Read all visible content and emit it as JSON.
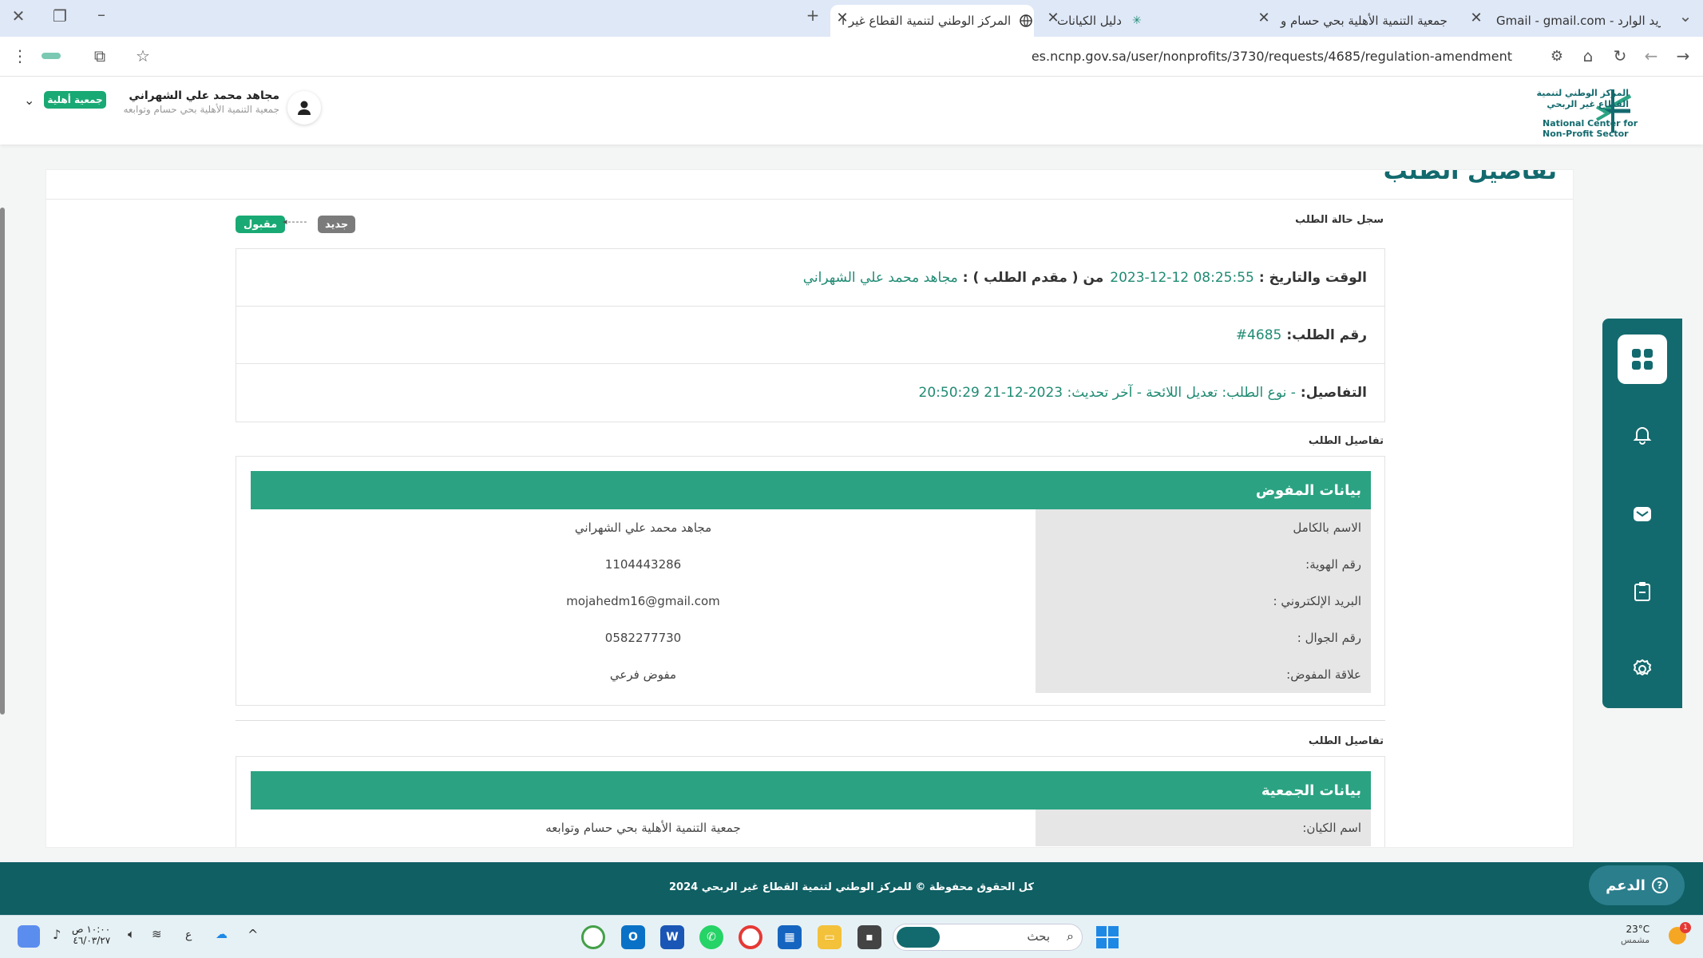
{
  "browser": {
    "tabs": [
      {
        "title": "البريد الوارد - Gmail - gmail.com",
        "favicon": "gmail-icon"
      },
      {
        "title": "جمعية التنمية الأهلية بحي حسام و",
        "favicon": "r-icon"
      },
      {
        "title": "دليل الكيانات",
        "favicon": "ncnp-icon"
      },
      {
        "title": "المركز الوطني لتنمية القطاع غير ا",
        "favicon": "globe-icon",
        "active": true
      }
    ],
    "url": "es.ncnp.gov.sa/user/nonprofits/3730/requests/4685/regulation-amendment",
    "new_tab": "+"
  },
  "header": {
    "logo_lines": [
      "المركز الوطني لتنمية",
      "القطاع غير الربحي",
      "National Center for",
      "Non-Profit Sector"
    ],
    "user_name": "مجاهد محمد علي الشهراني",
    "org_name": "جمعية التنمية الأهلية بحي حسام وتوابعه",
    "badge": "جمعية أهلية"
  },
  "page_heading_partial": "تفاصيل الطلب",
  "status_log": {
    "title": "سجل حالة الطلب",
    "from_status": "جديد",
    "arrow": "◂-----",
    "to_status": "مقبول"
  },
  "request_info": {
    "datetime_label": "الوقت والتاريخ :",
    "datetime_value": "2023-12-12 08:25:55",
    "from_label": "من ( مقدم الطلب ) :",
    "from_value": "مجاهد محمد علي الشهراني",
    "number_label": "رقم الطلب:",
    "number_value": "#4685",
    "details_label": "التفاصيل:",
    "details_value": "- نوع الطلب: تعديل اللائحة - آخر تحديث: 2023-12-21 20:50:29"
  },
  "delegate_section": {
    "section_title": "تفاصيل الطلب",
    "panel_title": "بيانات المفوض",
    "rows": [
      {
        "label": "الاسم بالكامل",
        "value": "مجاهد محمد علي الشهراني"
      },
      {
        "label": "رقم الهوية:",
        "value": "1104443286"
      },
      {
        "label": "البريد الإلكتروني :",
        "value": "mojahedm16@gmail.com"
      },
      {
        "label": "رقم الجوال :",
        "value": "0582277730"
      },
      {
        "label": "علاقة المفوض:",
        "value": "مفوض فرعي"
      }
    ]
  },
  "org_section": {
    "section_title": "تفاصيل الطلب",
    "panel_title": "بيانات الجمعية",
    "rows": [
      {
        "label": "اسم الكيان:",
        "value": "جمعية التنمية الأهلية بحي حسام وتوابعه"
      }
    ]
  },
  "support_button": "الدعم",
  "footer_text": "كل الحقوق محفوظة © للمركز الوطني لتنمية القطاع غير الربحي 2024",
  "taskbar": {
    "weather_temp": "23°C",
    "weather_desc": "مشمس",
    "search_placeholder": "بحث",
    "time": "١٠:٠٠ ص",
    "date": "٤٦/٠٣/٢٧",
    "lang": "ع",
    "notification_count": "1"
  },
  "colors": {
    "primary_green": "#2ba383",
    "dark_teal": "#0f5f63",
    "text_teal": "#1f8b73",
    "badge_green": "#19a974"
  }
}
